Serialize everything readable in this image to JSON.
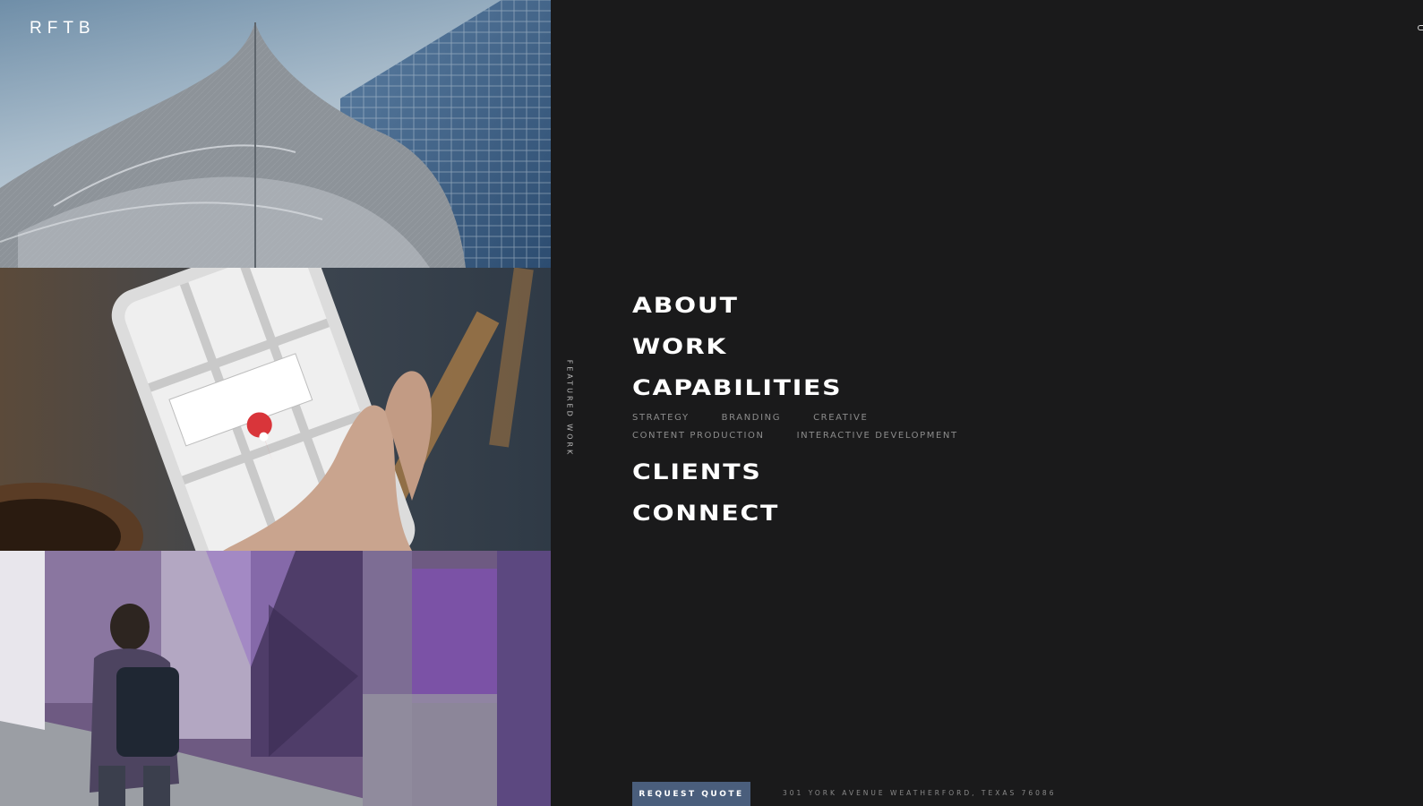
{
  "brand": {
    "logo_text": "RFTB"
  },
  "gallery": {
    "featured_label": "FEATURED WORK",
    "tiles": [
      {
        "subject": "modern-building-architecture"
      },
      {
        "subject": "phone-map-app"
      },
      {
        "subject": "purple-mural-hallway"
      }
    ]
  },
  "nav": {
    "items": [
      {
        "label": "ABOUT"
      },
      {
        "label": "WORK"
      },
      {
        "label": "CAPABILITIES"
      },
      {
        "label": "CLIENTS"
      },
      {
        "label": "CONNECT"
      }
    ],
    "capabilities": {
      "row1": [
        "STRATEGY",
        "BRANDING",
        "CREATIVE"
      ],
      "row2": [
        "CONTENT PRODUCTION",
        "INTERACTIVE DEVELOPMENT"
      ]
    }
  },
  "footer": {
    "request_quote_label": "REQUEST QUOTE",
    "address": "301 YORK AVENUE WEATHERFORD, TEXAS 76086"
  },
  "colors": {
    "background": "#1a1a1b",
    "button": "#4a5e7c",
    "muted_text": "#8c8c8c"
  }
}
